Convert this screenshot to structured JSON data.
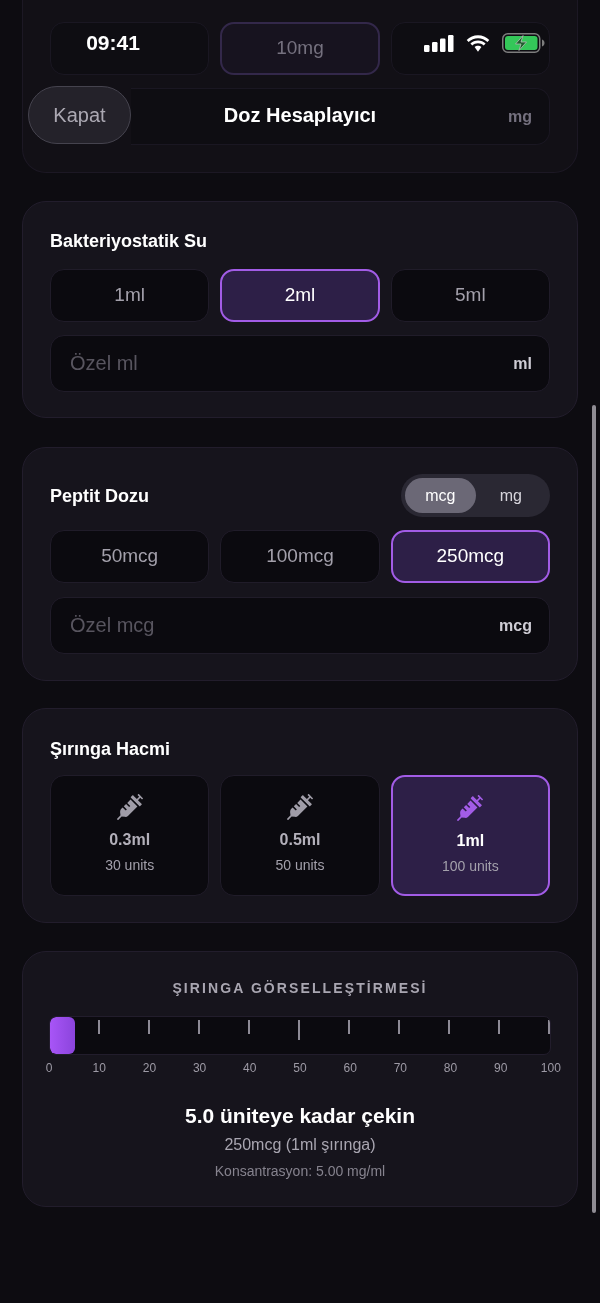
{
  "status_bar": {
    "time": "09:41"
  },
  "header": {
    "close_button": "Kapat",
    "title": "Doz Hesaplayıcı"
  },
  "vial_card": {
    "options": [
      {
        "selected": false
      },
      {
        "label": "10mg",
        "selected": true
      },
      {
        "selected": false
      }
    ],
    "custom_field": {
      "unit": "mg"
    }
  },
  "water_card": {
    "title": "Bakteriyostatik Su",
    "options": [
      {
        "label": "1ml",
        "selected": false
      },
      {
        "label": "2ml",
        "selected": true
      },
      {
        "label": "5ml",
        "selected": false
      }
    ],
    "custom_field": {
      "placeholder": "Özel ml",
      "unit": "ml"
    }
  },
  "dose_card": {
    "title": "Peptit Dozu",
    "unit_toggle": [
      {
        "label": "mcg",
        "selected": true
      },
      {
        "label": "mg",
        "selected": false
      }
    ],
    "options": [
      {
        "label": "50mcg",
        "selected": false
      },
      {
        "label": "100mcg",
        "selected": false
      },
      {
        "label": "250mcg",
        "selected": true
      }
    ],
    "custom_field": {
      "placeholder": "Özel mcg",
      "unit": "mcg"
    }
  },
  "syringe_card": {
    "title": "Şırınga Hacmi",
    "options": [
      {
        "volume": "0.3ml",
        "units": "30 units",
        "selected": false
      },
      {
        "volume": "0.5ml",
        "units": "50 units",
        "selected": false
      },
      {
        "volume": "1ml",
        "units": "100 units",
        "selected": true
      }
    ]
  },
  "visualization": {
    "title": "ŞIRINGA GÖRSELLEŞTİRMESİ",
    "level": 0.05,
    "tick_labels": [
      "0",
      "10",
      "20",
      "30",
      "40",
      "50",
      "60",
      "70",
      "80",
      "90",
      "100"
    ],
    "result": "5.0 üniteye kadar çekin",
    "detail": "250mcg (1ml şırınga)",
    "concentration": "Konsantrasyon: 5.00 mg/ml"
  }
}
